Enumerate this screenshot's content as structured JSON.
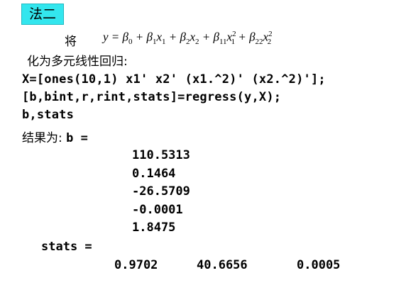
{
  "title": "法二",
  "equation": {
    "prefix": "将",
    "lhs": "y",
    "beta": "β",
    "x": "x",
    "sub_0": "0",
    "sub_1": "1",
    "sub_2": "2",
    "sub_11": "11",
    "sub_22": "22",
    "sup_2": "2",
    "eq": " = ",
    "plus": " + "
  },
  "intro_text": "化为多元线性回归:",
  "code_lines": [
    "X=[ones(10,1) x1' x2' (x1.^2)' (x2.^2)'];",
    "[b,bint,r,rint,stats]=regress(y,X);",
    "b,stats"
  ],
  "result": {
    "label_cn": "结果为: ",
    "label_var": "b ="
  },
  "b_values": [
    "110.5313",
    "0.1464",
    "-26.5709",
    "-0.0001",
    "1.8475"
  ],
  "stats_label": "stats =",
  "stats_values": [
    "0.9702",
    "40.6656",
    "0.0005"
  ]
}
